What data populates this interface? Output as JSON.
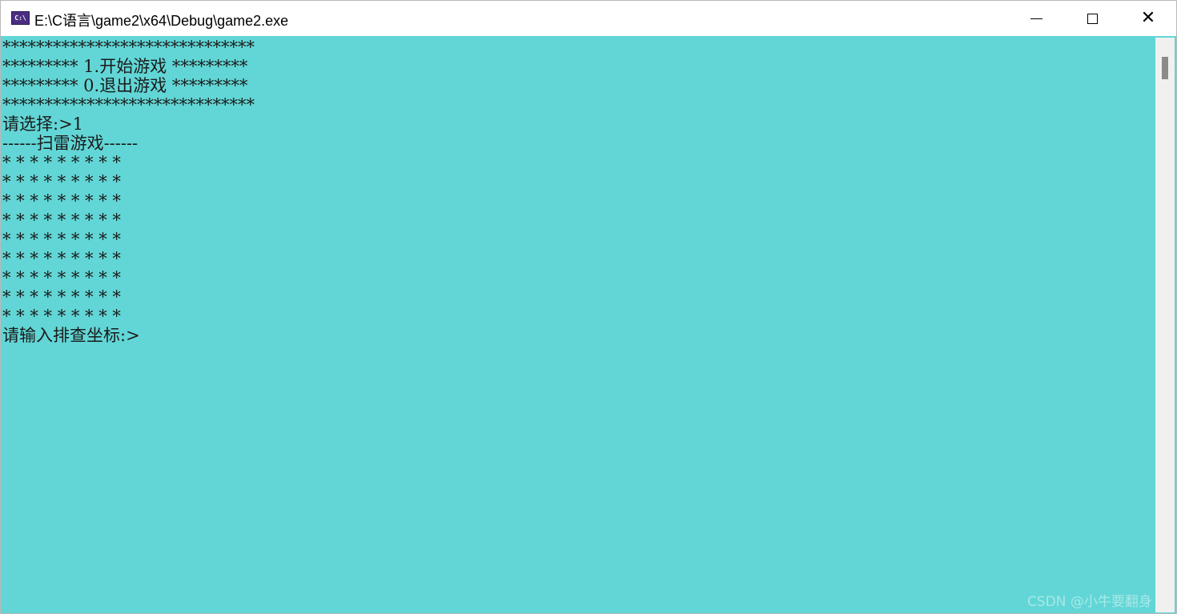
{
  "window": {
    "title": "E:\\C语言\\game2\\x64\\Debug\\game2.exe",
    "icon_label": "C:\\",
    "icon": "console-app-icon",
    "controls": {
      "minimize_icon": "minimize-icon",
      "maximize_icon": "maximize-icon",
      "close_icon": "close-icon",
      "close_glyph": "✕"
    }
  },
  "console": {
    "background": "#62d6d6",
    "text_color": "#1b1b1b",
    "lines": [
      "******************************",
      "********* 1.开始游戏 *********",
      "********* 0.退出游戏 *********",
      "******************************",
      "请选择:>1",
      "------扫雷游戏------",
      "* * * * * * * * *",
      "* * * * * * * * *",
      "* * * * * * * * *",
      "* * * * * * * * *",
      "* * * * * * * * *",
      "* * * * * * * * *",
      "* * * * * * * * *",
      "* * * * * * * * *",
      "* * * * * * * * *",
      "请输入排查坐标:>"
    ]
  },
  "watermark": "CSDN @小牛要翻身"
}
